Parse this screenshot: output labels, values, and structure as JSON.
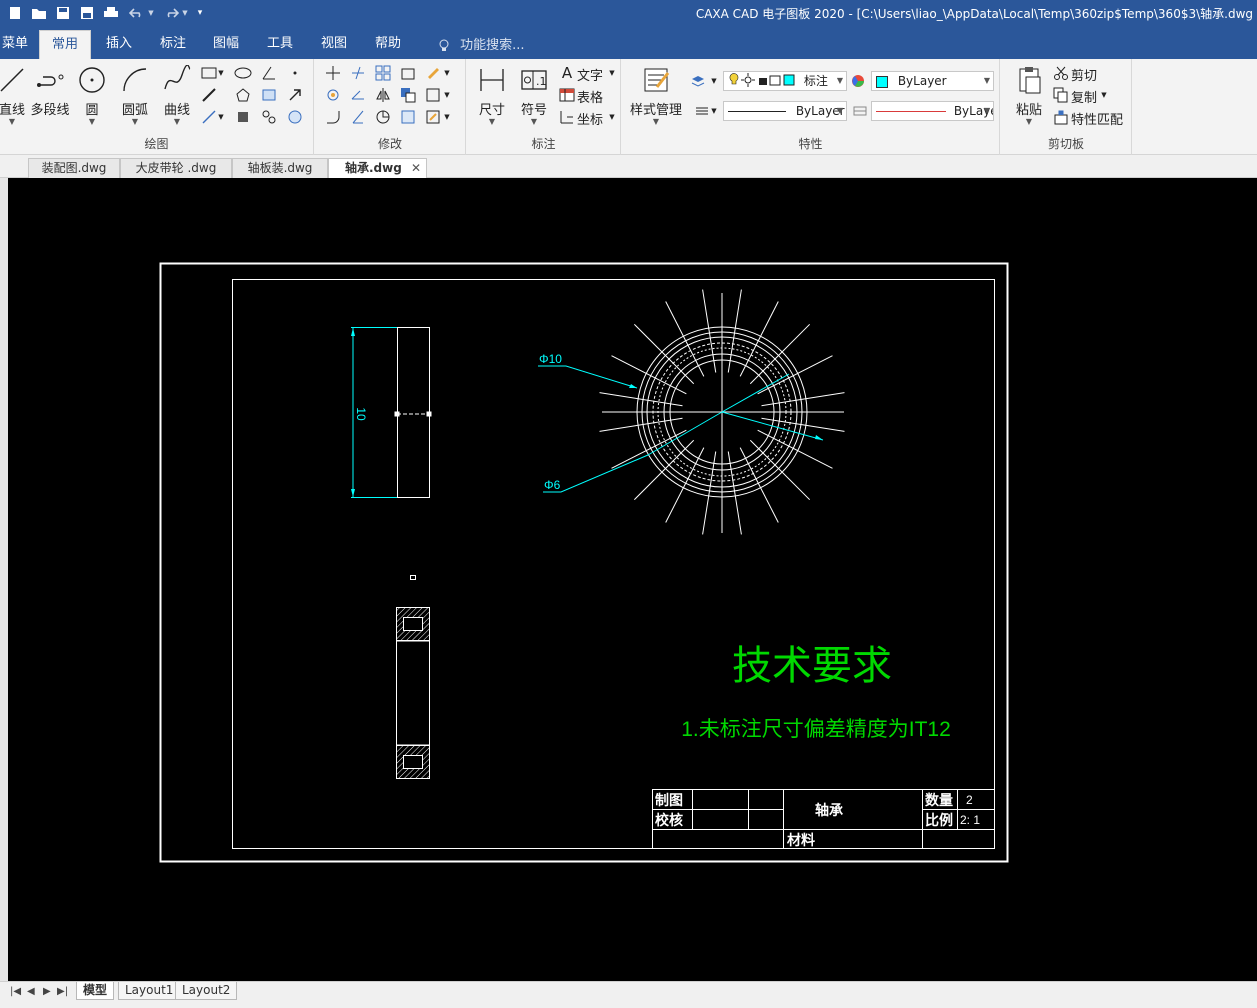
{
  "app": {
    "title": "CAXA CAD 电子图板 2020 - [C:\\Users\\liao_\\AppData\\Local\\Temp\\360zip$Temp\\360$3\\轴承.dwg"
  },
  "menu": {
    "tabs": [
      "菜单",
      "常用",
      "插入",
      "标注",
      "图幅",
      "工具",
      "视图",
      "帮助"
    ],
    "active": "常用",
    "search_label": "功能搜索..."
  },
  "ribbon": {
    "draw": {
      "label": "绘图",
      "line": "直线",
      "polyline": "多段线",
      "circle": "圆",
      "arc": "圆弧",
      "curve": "曲线"
    },
    "modify": {
      "label": "修改"
    },
    "annotate": {
      "label": "标注",
      "dimension": "尺寸",
      "symbol": "符号",
      "text": "文字",
      "table": "表格",
      "coordinate": "坐标"
    },
    "properties": {
      "label": "特性",
      "style_manager": "样式管理",
      "layer_combo": "标注",
      "color_combo": "ByLayer",
      "linetype_combo": "ByLayer",
      "lineweight_combo": "ByLaye"
    },
    "clipboard": {
      "label": "剪切板",
      "paste": "粘贴",
      "cut": "剪切",
      "copy": "复制",
      "match": "特性匹配"
    }
  },
  "documents": {
    "tabs": [
      "装配图.dwg",
      "大皮带轮 .dwg",
      "轴板装.dwg",
      "轴承.dwg"
    ],
    "active_index": 3
  },
  "drawing": {
    "dim_height": "10",
    "dim_outer": "Φ10",
    "dim_inner": "Φ6",
    "tech_title": "技术要求",
    "tech_note": "1.未标注尺寸偏差精度为IT12",
    "titleblock": {
      "drawn_by": "制图",
      "checked_by": "校核",
      "part_name": "轴承",
      "quantity_label": "数量",
      "quantity_value": "2",
      "scale_label": "比例",
      "scale_value": "2: 1",
      "material_label": "材料"
    }
  },
  "layouts": {
    "tabs": [
      "模型",
      "Layout1",
      "Layout2"
    ],
    "active": "模型"
  },
  "colors": {
    "titlebar": "#2b579a",
    "ribbon_bg": "#f3f3f3",
    "canvas": "#000000",
    "dimension": "#00ffff",
    "tech_text": "#00d800",
    "outline": "#ffffff"
  }
}
